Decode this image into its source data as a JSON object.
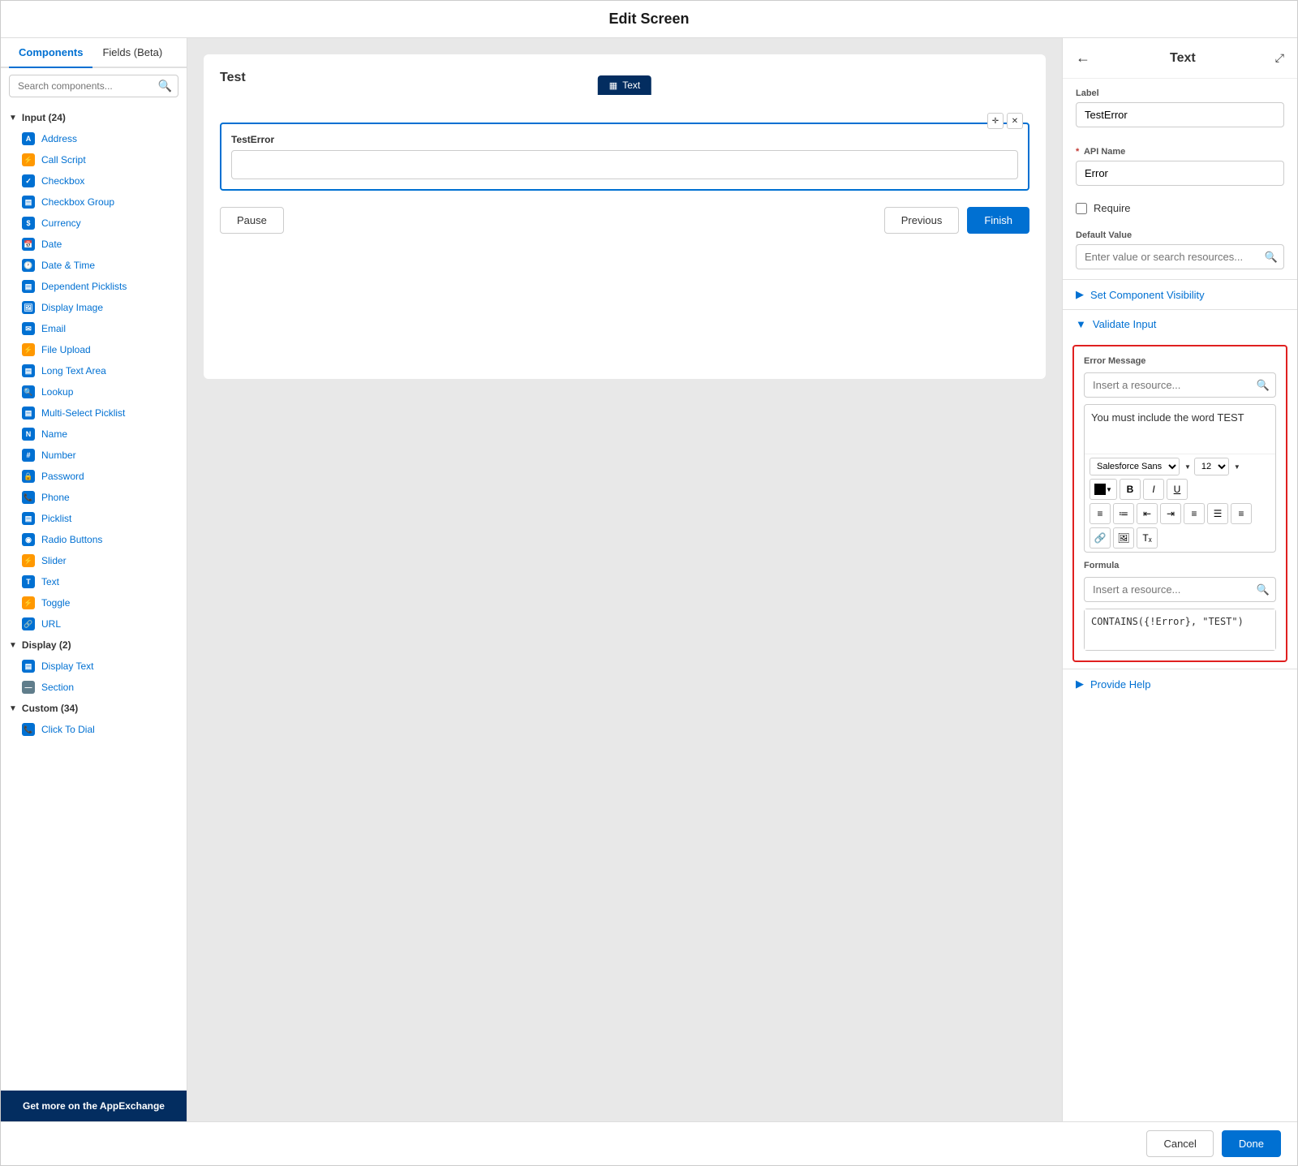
{
  "header": {
    "title": "Edit Screen"
  },
  "sidebar": {
    "tab_components": "Components",
    "tab_fields": "Fields (Beta)",
    "search_placeholder": "Search components...",
    "groups": [
      {
        "label": "Input (24)",
        "items": [
          {
            "label": "Address",
            "icon": "A",
            "color": "blue"
          },
          {
            "label": "Call Script",
            "icon": "⚡",
            "color": "orange"
          },
          {
            "label": "Checkbox",
            "icon": "✓",
            "color": "blue"
          },
          {
            "label": "Checkbox Group",
            "icon": "☰",
            "color": "blue"
          },
          {
            "label": "Currency",
            "icon": "$",
            "color": "blue"
          },
          {
            "label": "Date",
            "icon": "📅",
            "color": "blue"
          },
          {
            "label": "Date & Time",
            "icon": "🕐",
            "color": "blue"
          },
          {
            "label": "Dependent Picklists",
            "icon": "▤",
            "color": "blue"
          },
          {
            "label": "Display Image",
            "icon": "🖼",
            "color": "blue"
          },
          {
            "label": "Email",
            "icon": "✉",
            "color": "blue"
          },
          {
            "label": "File Upload",
            "icon": "⚡",
            "color": "orange"
          },
          {
            "label": "Long Text Area",
            "icon": "▤",
            "color": "blue"
          },
          {
            "label": "Lookup",
            "icon": "🔍",
            "color": "blue"
          },
          {
            "label": "Multi-Select Picklist",
            "icon": "▤",
            "color": "blue"
          },
          {
            "label": "Name",
            "icon": "N",
            "color": "blue"
          },
          {
            "label": "Number",
            "icon": "#",
            "color": "blue"
          },
          {
            "label": "Password",
            "icon": "🔒",
            "color": "blue"
          },
          {
            "label": "Phone",
            "icon": "📞",
            "color": "blue"
          },
          {
            "label": "Picklist",
            "icon": "▤",
            "color": "blue"
          },
          {
            "label": "Radio Buttons",
            "icon": "◉",
            "color": "blue"
          },
          {
            "label": "Slider",
            "icon": "⚡",
            "color": "orange"
          },
          {
            "label": "Text",
            "icon": "T",
            "color": "blue"
          },
          {
            "label": "Toggle",
            "icon": "⚡",
            "color": "orange"
          },
          {
            "label": "URL",
            "icon": "🔗",
            "color": "blue"
          }
        ]
      },
      {
        "label": "Display (2)",
        "items": [
          {
            "label": "Display Text",
            "icon": "▤",
            "color": "blue"
          },
          {
            "label": "Section",
            "icon": "—",
            "color": "gray"
          }
        ]
      },
      {
        "label": "Custom (34)",
        "items": [
          {
            "label": "Click To Dial",
            "icon": "📞",
            "color": "blue"
          }
        ]
      }
    ],
    "footer": "Get more on the AppExchange"
  },
  "canvas": {
    "title": "Test",
    "component_tab_label": "Text",
    "component_label": "TestError",
    "button_pause": "Pause",
    "button_previous": "Previous",
    "button_finish": "Finish"
  },
  "right_panel": {
    "title": "Text",
    "label_field": "Label",
    "label_value": "TestError",
    "api_name_field": "API Name",
    "api_name_value": "Error",
    "require_label": "Require",
    "default_value_label": "Default Value",
    "default_value_placeholder": "Enter value or search resources...",
    "set_visibility_label": "Set Component Visibility",
    "validate_input_label": "Validate Input",
    "error_message_label": "Error Message",
    "error_message_resource_placeholder": "Insert a resource...",
    "error_message_text": "You must include the word TEST",
    "font_family": "Salesforce Sans",
    "font_size": "12",
    "formula_label": "Formula",
    "formula_resource_placeholder": "Insert a resource...",
    "formula_text": "CONTAINS({!Error}, \"TEST\")",
    "provide_help_label": "Provide Help"
  },
  "footer": {
    "cancel_label": "Cancel",
    "done_label": "Done"
  }
}
